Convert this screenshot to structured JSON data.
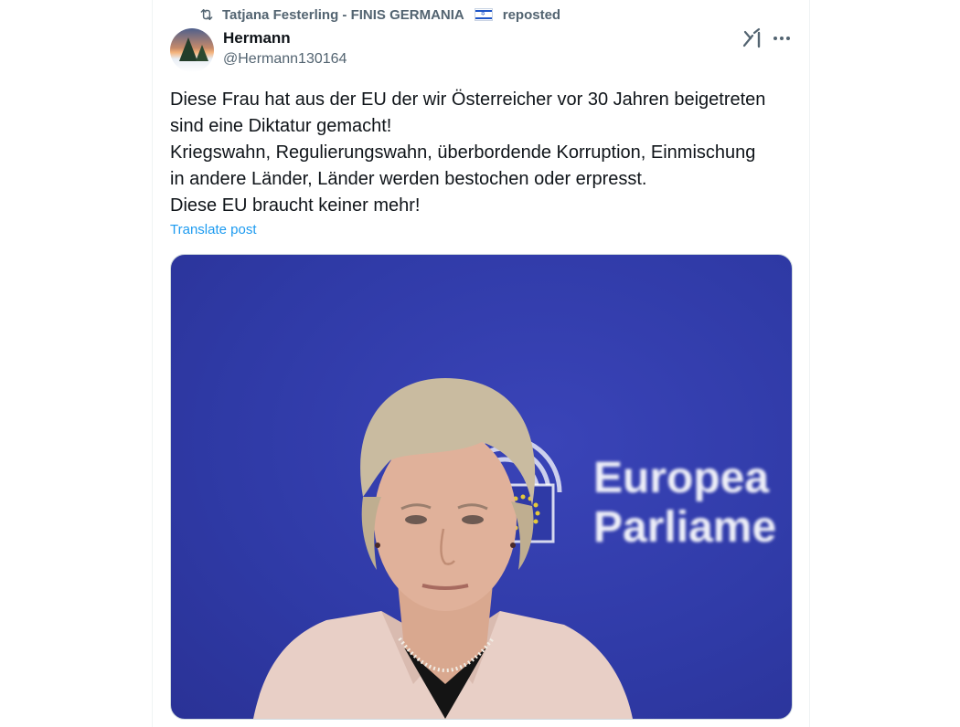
{
  "repost": {
    "icon": "repost-icon",
    "text": "Tatjana Festerling - FINIS GERMANIA",
    "flag": "israel-flag-emoji",
    "suffix": "reposted"
  },
  "author": {
    "name": "Hermann",
    "handle": "@Hermann130164"
  },
  "post": {
    "lines": [
      "Diese Frau hat aus der EU der wir Österreicher vor 30 Jahren beigetreten",
      "sind eine Diktatur gemacht!",
      "Kriegswahn, Regulierungswahn, überbordende Korruption, Einmischung",
      "in andere Länder, Länder werden bestochen oder erpresst.",
      "Diese EU braucht keiner mehr!"
    ],
    "translate_label": "Translate post"
  },
  "media": {
    "backdrop_text": [
      "Europea",
      "Parliame"
    ]
  },
  "colors": {
    "text": "#0f1419",
    "secondary": "#536471",
    "link": "#1d9bf0",
    "media_bg": "#2f3aa6"
  }
}
